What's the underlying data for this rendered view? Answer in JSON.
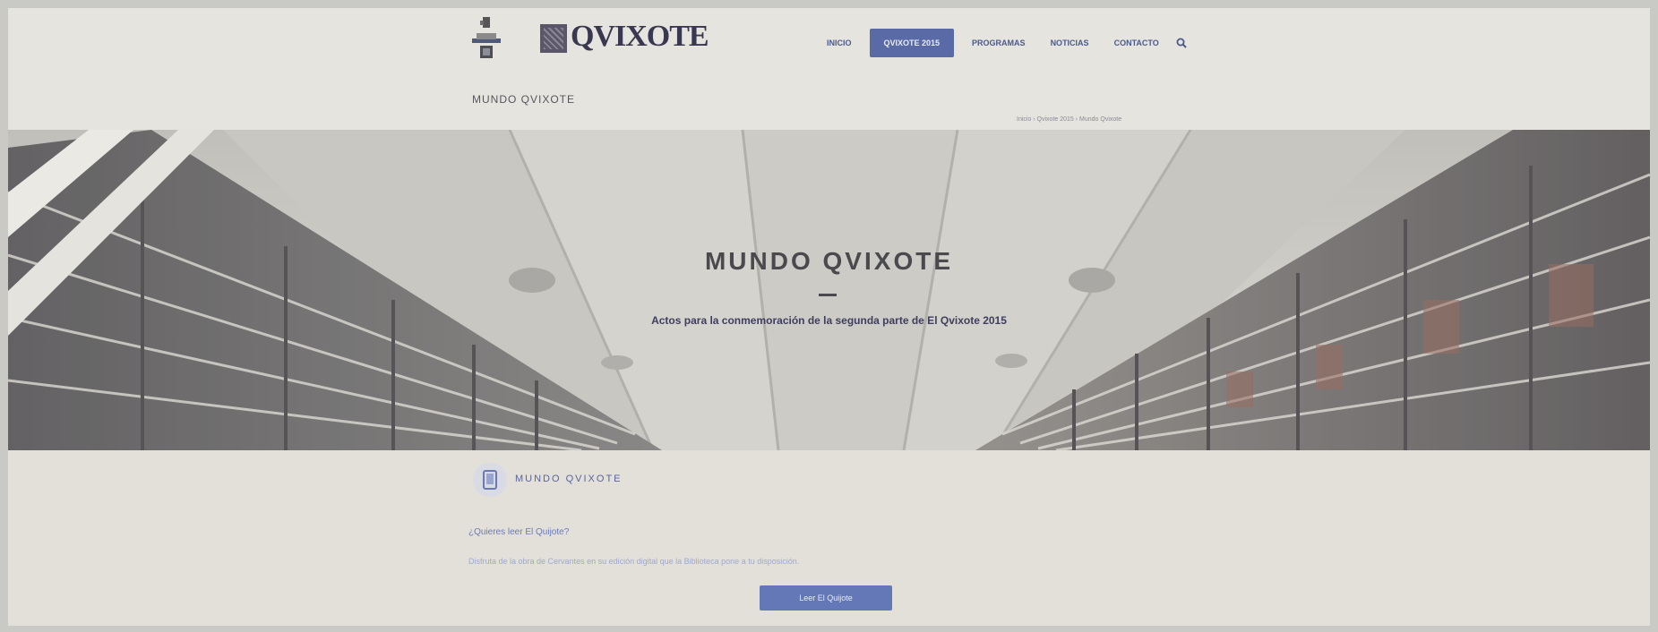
{
  "header": {
    "brand": {
      "name": "QVIXOTE",
      "tagline": "MUNDO QVIXOTE"
    },
    "nav": [
      {
        "label": "INICIO",
        "active": false
      },
      {
        "label": "QVIXOTE 2015",
        "active": true
      },
      {
        "label": "PROGRAMAS",
        "active": false
      },
      {
        "label": "NOTICIAS",
        "active": false
      },
      {
        "label": "CONTACTO",
        "active": false
      }
    ],
    "page_title": "MUNDO QVIXOTE",
    "breadcrumb": "Inicio › Qvixote 2015 › Mundo Qvixote"
  },
  "hero": {
    "title": "MUNDO QVIXOTE",
    "subtitle": "Actos para la conmemoración de la segunda parte de El Qvixote 2015"
  },
  "content": {
    "section_title": "MUNDO QVIXOTE",
    "question": "¿Quieres leer El Quijote?",
    "body": "Disfruta de la obra de Cervantes en su edición digital que la Biblioteca pone a tu disposición.",
    "button_label": "Leer El Quijote"
  },
  "colors": {
    "accent": "#5a6aa6",
    "nav_text": "#4b5a8a",
    "background": "#e4e2dc"
  }
}
